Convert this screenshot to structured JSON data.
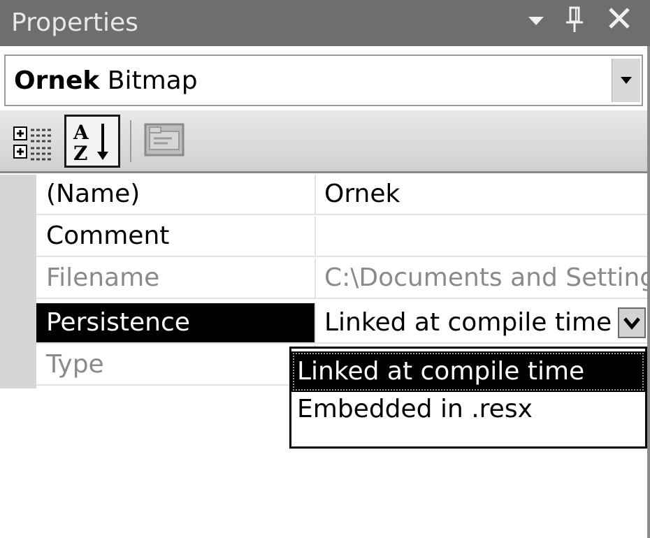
{
  "window": {
    "title": "Properties",
    "buttons": {
      "dropdown": "window-position",
      "pin": "auto-hide",
      "close": "close"
    }
  },
  "object_selector": {
    "name": "Ornek",
    "type": "Bitmap"
  },
  "toolbar": {
    "items": [
      {
        "name": "categorized",
        "icon": "categorized-icon",
        "active": false
      },
      {
        "name": "alphabetical",
        "icon": "sort-az-icon",
        "active": true
      },
      {
        "name": "property-pages",
        "icon": "property-pages-icon",
        "active": false,
        "enabled": false
      }
    ]
  },
  "properties": [
    {
      "name": "(Name)",
      "value": "Ornek",
      "muted": false,
      "selected": false
    },
    {
      "name": "Comment",
      "value": "",
      "muted": false,
      "selected": false
    },
    {
      "name": "Filename",
      "value": "C:\\Documents and Settings",
      "muted": true,
      "selected": false
    },
    {
      "name": "Persistence",
      "value": "Linked at compile time",
      "muted": false,
      "selected": true
    },
    {
      "name": "Type",
      "value": "",
      "muted": true,
      "selected": false
    }
  ],
  "dropdown": {
    "open": true,
    "options": [
      "Linked at compile time",
      "Embedded in .resx"
    ],
    "selected": "Linked at compile time"
  },
  "colors": {
    "titlebar": "#6e6e6e",
    "selection": "#000000",
    "margin": "#d6d6d6",
    "muted_text": "#8a8a8a"
  }
}
